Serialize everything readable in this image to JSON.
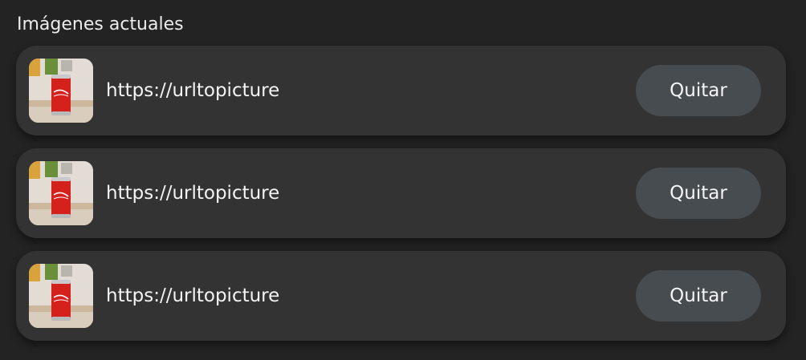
{
  "section": {
    "title": "Imágenes actuales"
  },
  "images": [
    {
      "url": "https://urltopicture",
      "remove_label": "Quitar",
      "thumbnail": "red-soda-can-photo"
    },
    {
      "url": "https://urltopicture",
      "remove_label": "Quitar",
      "thumbnail": "red-soda-can-photo"
    },
    {
      "url": "https://urltopicture",
      "remove_label": "Quitar",
      "thumbnail": "red-soda-can-photo"
    }
  ],
  "colors": {
    "background": "#232323",
    "row": "#333333",
    "button": "#474c50",
    "text": "#f4f4f4"
  }
}
